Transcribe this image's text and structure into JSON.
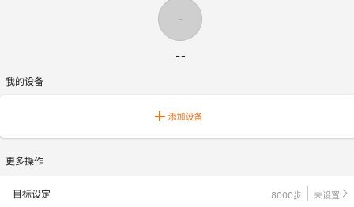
{
  "profile": {
    "avatar_text": "-",
    "name": "--"
  },
  "devices": {
    "section_title": "我的设备",
    "add_label": "添加设备",
    "add_icon": "plus-icon"
  },
  "more": {
    "section_title": "更多操作",
    "goal": {
      "label": "目标设定",
      "value": "8000步",
      "status": "未设置",
      "chevron_icon": "chevron-right-icon"
    }
  },
  "colors": {
    "accent": "#e8731a",
    "background": "#f4f4f4",
    "card": "#ffffff",
    "muted_text": "#9a9a9a"
  }
}
